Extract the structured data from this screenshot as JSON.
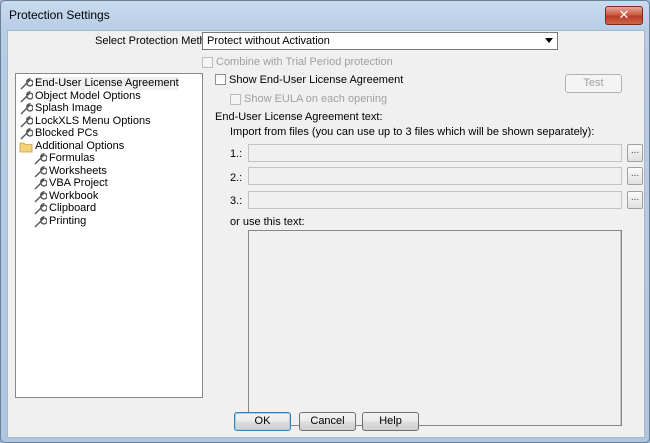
{
  "window": {
    "title": "Protection Settings",
    "close_glyph": "✕"
  },
  "method": {
    "label": "Select Protection Method:",
    "value": "Protect without Activation"
  },
  "trial": {
    "label": "Combine with Trial Period protection"
  },
  "tree": {
    "items": [
      {
        "label": "End-User License Agreement",
        "icon": "wrench-icon"
      },
      {
        "label": "Object Model Options",
        "icon": "wrench-icon"
      },
      {
        "label": "Splash Image",
        "icon": "wrench-icon"
      },
      {
        "label": "LockXLS Menu Options",
        "icon": "wrench-icon"
      },
      {
        "label": "Blocked PCs",
        "icon": "wrench-icon"
      },
      {
        "label": "Additional Options",
        "icon": "folder-icon"
      },
      {
        "label": "Formulas",
        "icon": "wrench-icon"
      },
      {
        "label": "Worksheets",
        "icon": "wrench-icon"
      },
      {
        "label": "VBA Project",
        "icon": "wrench-icon"
      },
      {
        "label": "Workbook",
        "icon": "wrench-icon"
      },
      {
        "label": "Clipboard",
        "icon": "wrench-icon"
      },
      {
        "label": "Printing",
        "icon": "wrench-icon"
      }
    ]
  },
  "eula": {
    "show_label": "Show End-User License Agreement",
    "test_label": "Test",
    "each_open_label": "Show EULA on each opening",
    "text_label": "End-User License Agreement text:",
    "import_label": "Import from files (you can use up to 3 files which will be shown separately):",
    "files": [
      {
        "label": "1.:",
        "browse": "..."
      },
      {
        "label": "2.:",
        "browse": "..."
      },
      {
        "label": "3.:",
        "browse": "..."
      }
    ],
    "use_text_label": "or use this text:"
  },
  "buttons": {
    "ok": "OK",
    "cancel": "Cancel",
    "help": "Help"
  },
  "colors": {
    "titlebar": "#c8dbef",
    "close": "#c9553f",
    "dialog_bg": "#f0f0f0",
    "default_border": "#3c7fb1"
  }
}
